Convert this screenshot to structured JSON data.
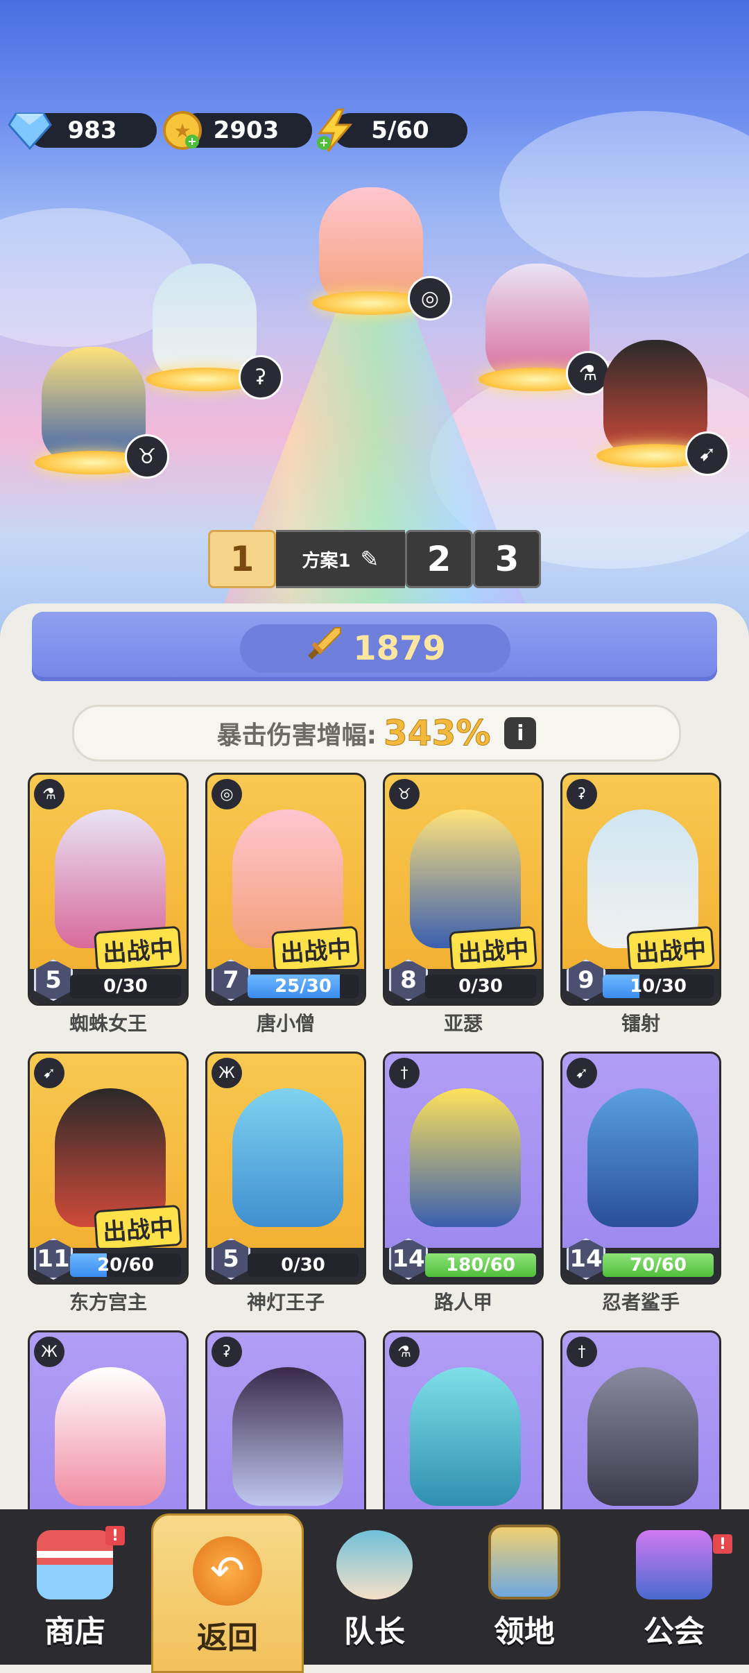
{
  "resources": {
    "gems": "983",
    "coins": "2903",
    "energy": "5/60"
  },
  "plans": {
    "tabs": [
      "1",
      "2",
      "3"
    ],
    "active_name": "方案1"
  },
  "power": "1879",
  "crit": {
    "label": "暴击伤害增幅:",
    "value": "343%",
    "info": "i"
  },
  "deploy_label": "出战中",
  "cards": [
    {
      "name": "蜘蛛女王",
      "level": "5",
      "progress": "0/30",
      "fill": 0.0,
      "bar": "blue",
      "deployed": true,
      "frame": "gold"
    },
    {
      "name": "唐小僧",
      "level": "7",
      "progress": "25/30",
      "fill": 0.83,
      "bar": "blue",
      "deployed": true,
      "frame": "gold"
    },
    {
      "name": "亚瑟",
      "level": "8",
      "progress": "0/30",
      "fill": 0.0,
      "bar": "blue",
      "deployed": true,
      "frame": "gold"
    },
    {
      "name": "镭射",
      "level": "9",
      "progress": "10/30",
      "fill": 0.33,
      "bar": "blue",
      "deployed": true,
      "frame": "gold"
    },
    {
      "name": "东方宫主",
      "level": "11",
      "progress": "20/60",
      "fill": 0.33,
      "bar": "blue",
      "deployed": true,
      "frame": "gold"
    },
    {
      "name": "神灯王子",
      "level": "5",
      "progress": "0/30",
      "fill": 0.0,
      "bar": "blue",
      "deployed": false,
      "frame": "gold"
    },
    {
      "name": "路人甲",
      "level": "14",
      "progress": "180/60",
      "fill": 1.0,
      "bar": "green",
      "deployed": false,
      "frame": "purple"
    },
    {
      "name": "忍者鲨手",
      "level": "14",
      "progress": "70/60",
      "fill": 1.0,
      "bar": "green",
      "deployed": false,
      "frame": "purple"
    }
  ],
  "nav": {
    "shop": "商店",
    "back": "返回",
    "captain": "队长",
    "territory": "领地",
    "guild": "公会",
    "alert_mark": "!"
  },
  "colors": {
    "gold_frame": "#f2ad2e",
    "purple_frame": "#9b86ee",
    "accent_yellow": "#f2c15a",
    "dark": "#2b2b30"
  }
}
